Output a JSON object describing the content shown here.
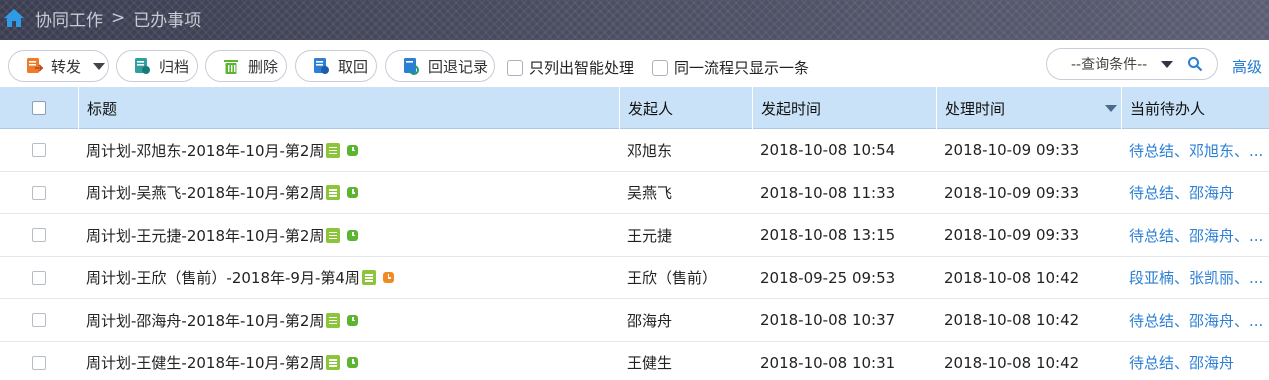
{
  "breadcrumb": {
    "root": "协同工作",
    "separator": ">",
    "current": "已办事项"
  },
  "toolbar": {
    "forward": "转发",
    "archive": "归档",
    "delete": "删除",
    "retrieve": "取回",
    "rollback_log": "回退记录",
    "only_smart": "只列出智能处理",
    "same_flow_one": "同一流程只显示一条",
    "query_placeholder": "--查询条件--",
    "advanced": "高级"
  },
  "table": {
    "headers": {
      "title": "标题",
      "initiator": "发起人",
      "start_time": "发起时间",
      "process_time": "处理时间",
      "current_handler": "当前待办人"
    },
    "rows": [
      {
        "title": "周计划-邓旭东-2018年-10月-第2周",
        "initiator": "邓旭东",
        "start_time": "2018-10-08 10:54",
        "process_time": "2018-10-09 09:33",
        "handler": "待总结、邓旭东、...",
        "status_color": "#5cb531"
      },
      {
        "title": "周计划-吴燕飞-2018年-10月-第2周",
        "initiator": "吴燕飞",
        "start_time": "2018-10-08 11:33",
        "process_time": "2018-10-09 09:33",
        "handler": "待总结、邵海舟",
        "status_color": "#5cb531"
      },
      {
        "title": "周计划-王元捷-2018年-10月-第2周",
        "initiator": "王元捷",
        "start_time": "2018-10-08 13:15",
        "process_time": "2018-10-09 09:33",
        "handler": "待总结、邵海舟、...",
        "status_color": "#5cb531"
      },
      {
        "title": "周计划-王欣（售前）-2018年-9月-第4周",
        "initiator": "王欣（售前）",
        "start_time": "2018-09-25 09:53",
        "process_time": "2018-10-08 10:42",
        "handler": "段亚楠、张凯丽、...",
        "status_color": "#f08a24"
      },
      {
        "title": "周计划-邵海舟-2018年-10月-第2周",
        "initiator": "邵海舟",
        "start_time": "2018-10-08 10:37",
        "process_time": "2018-10-08 10:42",
        "handler": "待总结、邵海舟、...",
        "status_color": "#5cb531"
      },
      {
        "title": "周计划-王健生-2018年-10月-第2周",
        "initiator": "王健生",
        "start_time": "2018-10-08 10:31",
        "process_time": "2018-10-08 10:42",
        "handler": "待总结、邵海舟",
        "status_color": "#5cb531"
      }
    ]
  },
  "colors": {
    "header_bg": "#c9e2f7",
    "link": "#2b7fd4",
    "topbar": "#45475b"
  },
  "icons": {
    "home": "home-icon",
    "forward": "forward-icon",
    "archive": "archive-icon",
    "delete": "trash-icon",
    "retrieve": "retrieve-icon",
    "rollback": "rollback-icon",
    "search": "search-icon"
  }
}
